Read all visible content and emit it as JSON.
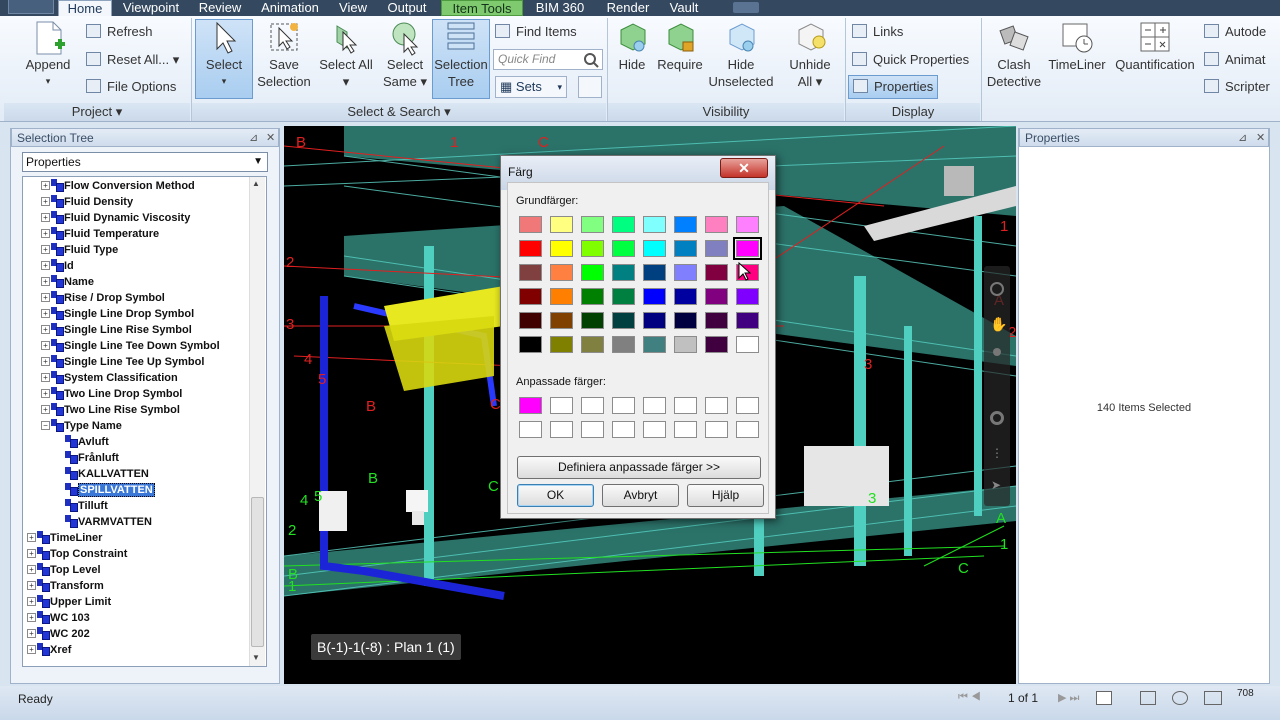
{
  "menu": {
    "tabs": [
      "Home",
      "Viewpoint",
      "Review",
      "Animation",
      "View",
      "Output",
      "Item Tools",
      "BIM 360",
      "Render",
      "Vault"
    ],
    "active": "Home",
    "contextual": "Item Tools"
  },
  "ribbon": {
    "project": {
      "label": "Project",
      "append": "Append",
      "refresh": "Refresh",
      "reset_all": "Reset All...",
      "file_options": "File Options"
    },
    "select_search": {
      "label": "Select & Search",
      "select": "Select",
      "save_selection": "Save Selection",
      "select_all": "Select All",
      "select_same": "Select Same",
      "selection_tree": "Selection Tree",
      "find_items": "Find Items",
      "quick_find_placeholder": "Quick Find",
      "sets": "Sets"
    },
    "visibility": {
      "label": "Visibility",
      "hide": "Hide",
      "require": "Require",
      "hide_unselected": "Hide Unselected",
      "unhide_all": "Unhide All"
    },
    "display": {
      "label": "Display",
      "links": "Links",
      "quick_properties": "Quick Properties",
      "properties": "Properties"
    },
    "tools": {
      "clash_detective": "Clash Detective",
      "timeliner": "TimeLiner",
      "quantification": "Quantification",
      "autodesk": "Autode",
      "animator": "Animat",
      "scripter": "Scripter"
    }
  },
  "selection_tree": {
    "title": "Selection Tree",
    "dropdown": "Properties",
    "rows": [
      {
        "label": "Flow Conversion Method",
        "level": 1,
        "toggle": "+"
      },
      {
        "label": "Fluid Density",
        "level": 1,
        "toggle": "+"
      },
      {
        "label": "Fluid Dynamic Viscosity",
        "level": 1,
        "toggle": "+"
      },
      {
        "label": "Fluid Temperature",
        "level": 1,
        "toggle": "+"
      },
      {
        "label": "Fluid Type",
        "level": 1,
        "toggle": "+"
      },
      {
        "label": "Id",
        "level": 1,
        "toggle": "+"
      },
      {
        "label": "Name",
        "level": 1,
        "toggle": "+"
      },
      {
        "label": "Rise / Drop Symbol",
        "level": 1,
        "toggle": "+"
      },
      {
        "label": "Single Line Drop Symbol",
        "level": 1,
        "toggle": "+"
      },
      {
        "label": "Single Line Rise Symbol",
        "level": 1,
        "toggle": "+"
      },
      {
        "label": "Single Line Tee Down Symbol",
        "level": 1,
        "toggle": "+"
      },
      {
        "label": "Single Line Tee Up Symbol",
        "level": 1,
        "toggle": "+"
      },
      {
        "label": "System Classification",
        "level": 1,
        "toggle": "+"
      },
      {
        "label": "Two Line Drop Symbol",
        "level": 1,
        "toggle": "+"
      },
      {
        "label": "Two Line Rise Symbol",
        "level": 1,
        "toggle": "+"
      },
      {
        "label": "Type Name",
        "level": 1,
        "toggle": "-"
      },
      {
        "label": "Avluft",
        "level": 2,
        "toggle": ""
      },
      {
        "label": "Frånluft",
        "level": 2,
        "toggle": ""
      },
      {
        "label": "KALLVATTEN",
        "level": 2,
        "toggle": ""
      },
      {
        "label": "SPILLVATTEN",
        "level": 2,
        "toggle": "",
        "selected": true
      },
      {
        "label": "Tilluft",
        "level": 2,
        "toggle": ""
      },
      {
        "label": "VARMVATTEN",
        "level": 2,
        "toggle": ""
      },
      {
        "label": "TimeLiner",
        "level": 0,
        "toggle": "+"
      },
      {
        "label": "Top Constraint",
        "level": 0,
        "toggle": "+"
      },
      {
        "label": "Top Level",
        "level": 0,
        "toggle": "+"
      },
      {
        "label": "Transform",
        "level": 0,
        "toggle": "+"
      },
      {
        "label": "Upper Limit",
        "level": 0,
        "toggle": "+"
      },
      {
        "label": "WC 103",
        "level": 0,
        "toggle": "+"
      },
      {
        "label": "WC 202",
        "level": 0,
        "toggle": "+"
      },
      {
        "label": "Xref",
        "level": 0,
        "toggle": "+"
      }
    ]
  },
  "viewport": {
    "view_label": "B(-1)-1(-8) : Plan 1 (1)",
    "grid_labels": [
      {
        "t": "B",
        "c": "#e02020"
      },
      {
        "t": "1",
        "c": "#e02020"
      },
      {
        "t": "C",
        "c": "#e02020"
      },
      {
        "t": "2",
        "c": "#e02020"
      },
      {
        "t": "3",
        "c": "#e02020"
      },
      {
        "t": "4",
        "c": "#e02020"
      },
      {
        "t": "5",
        "c": "#e02020"
      },
      {
        "t": "B",
        "c": "#e02020"
      },
      {
        "t": "C",
        "c": "#e02020"
      },
      {
        "t": "3",
        "c": "#e02020"
      },
      {
        "t": "1",
        "c": "#e02020"
      },
      {
        "t": "A",
        "c": "#e02020"
      },
      {
        "t": "2",
        "c": "#e02020"
      },
      {
        "t": "B",
        "c": "#22e022"
      },
      {
        "t": "C",
        "c": "#22e022"
      },
      {
        "t": "4",
        "c": "#22e022"
      },
      {
        "t": "5",
        "c": "#22e022"
      },
      {
        "t": "2",
        "c": "#22e022"
      },
      {
        "t": "B",
        "c": "#22e022"
      },
      {
        "t": "1",
        "c": "#22e022"
      },
      {
        "t": "A",
        "c": "#22e022"
      },
      {
        "t": "1",
        "c": "#22e022"
      },
      {
        "t": "C",
        "c": "#22e022"
      },
      {
        "t": "3",
        "c": "#22e022"
      }
    ]
  },
  "properties": {
    "title": "Properties",
    "message": "140 Items Selected"
  },
  "color_dialog": {
    "title": "Färg",
    "basic_label": "Grundfärger:",
    "custom_label": "Anpassade färger:",
    "basic_colors": [
      "#f07878",
      "#ffff80",
      "#80ff80",
      "#00ff80",
      "#80ffff",
      "#0080ff",
      "#ff80c0",
      "#ff80ff",
      "#ff0000",
      "#ffff00",
      "#80ff00",
      "#00ff40",
      "#00ffff",
      "#0080c0",
      "#8080c0",
      "#ff00ff",
      "#804040",
      "#ff8040",
      "#00ff00",
      "#008080",
      "#004080",
      "#8080ff",
      "#800040",
      "#ff0080",
      "#800000",
      "#ff8000",
      "#008000",
      "#008040",
      "#0000ff",
      "#0000a0",
      "#800080",
      "#8000ff",
      "#400000",
      "#804000",
      "#004000",
      "#004040",
      "#000080",
      "#000040",
      "#400040",
      "#400080",
      "#000000",
      "#808000",
      "#808040",
      "#808080",
      "#408080",
      "#c0c0c0",
      "#400040",
      "#ffffff"
    ],
    "selected_index": 15,
    "custom_colors": [
      "#ff00ff",
      "#ffffff",
      "#ffffff",
      "#ffffff",
      "#ffffff",
      "#ffffff",
      "#ffffff",
      "#ffffff",
      "#ffffff",
      "#ffffff",
      "#ffffff",
      "#ffffff",
      "#ffffff",
      "#ffffff",
      "#ffffff",
      "#ffffff"
    ],
    "define_custom": "Definiera anpassade färger >>",
    "ok": "OK",
    "cancel": "Avbryt",
    "help": "Hjälp"
  },
  "status": {
    "text": "Ready",
    "page": "1 of 1",
    "value": "708"
  }
}
